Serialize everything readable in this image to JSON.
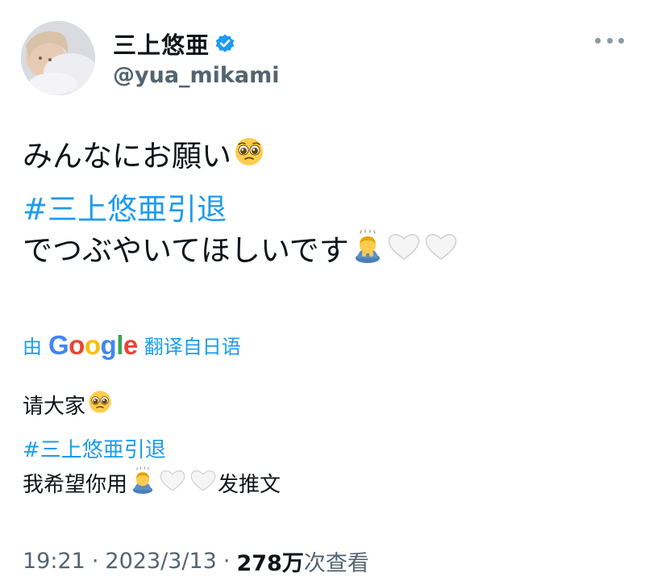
{
  "author": {
    "display_name": "三上悠亜",
    "handle": "@yua_mikami",
    "verified": true
  },
  "tweet": {
    "line1": "みんなにお願い",
    "hashtag": "#三上悠亜引退",
    "line3": "でつぶやいてほしいです"
  },
  "translation": {
    "prefix": "由",
    "provider_letters": [
      "G",
      "o",
      "o",
      "g",
      "l",
      "e"
    ],
    "suffix": "翻译自日语",
    "line1": "请大家",
    "hashtag": "#三上悠亜引退",
    "line3_part1": "我希望你用",
    "line3_part2": "发推文"
  },
  "meta": {
    "time": "19:21",
    "separator": "·",
    "date": "2023/3/13",
    "views_count": "278万",
    "views_label": " 次查看"
  },
  "icons": {
    "pleading": "pleading-face-emoji",
    "bowing": "person-bowing-emoji",
    "heart": "white-heart-emoji",
    "verified": "verified-badge-icon",
    "more": "more-options-icon"
  },
  "colors": {
    "link": "#1d9bf0",
    "muted": "#536471",
    "text": "#0f1419"
  }
}
